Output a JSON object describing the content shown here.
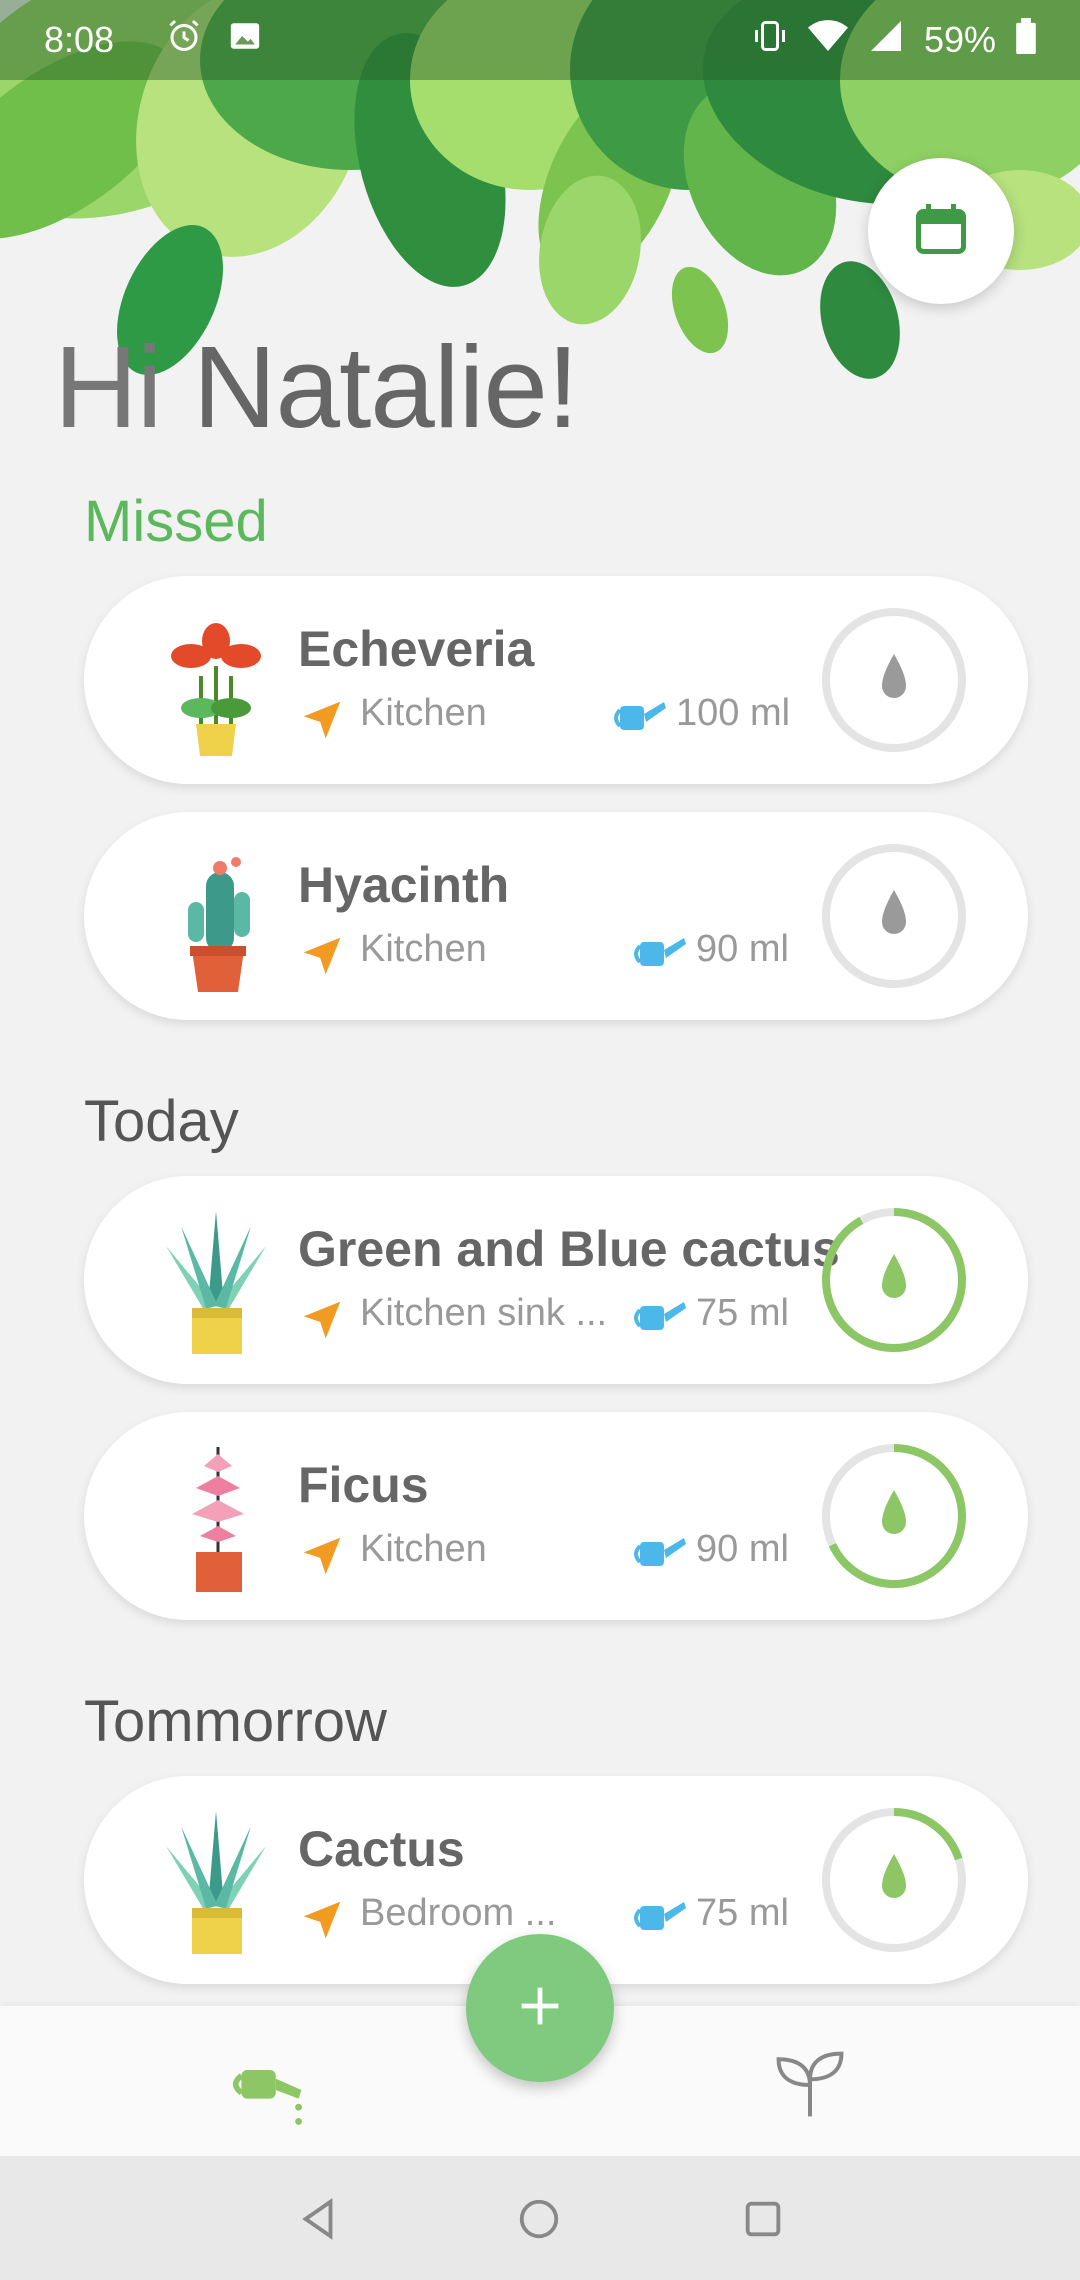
{
  "status_bar": {
    "time": "8:08",
    "battery": "59%",
    "icons": [
      "alarm-icon",
      "image-icon",
      "vibrate-icon",
      "wifi-icon",
      "signal-icon",
      "battery-icon"
    ]
  },
  "greeting": {
    "hi": "Hi",
    "name": "Natalie!"
  },
  "sections": {
    "missed": "Missed",
    "today": "Today",
    "tomorrow": "Tommorrow"
  },
  "plants": [
    {
      "name": "Echeveria",
      "location": "Kitchen",
      "amount": "100 ml",
      "progress": 0
    },
    {
      "name": "Hyacinth",
      "location": "Kitchen",
      "amount": "90 ml",
      "progress": 0
    },
    {
      "name": "Green and Blue cactus",
      "location": "Kitchen sink ...",
      "amount": "75 ml",
      "progress": 0.92
    },
    {
      "name": "Ficus",
      "location": "Kitchen",
      "amount": "90 ml",
      "progress": 0.68
    },
    {
      "name": "Cactus",
      "location": "Bedroom ...",
      "amount": "75 ml",
      "progress": 0.2
    }
  ],
  "colors": {
    "accent": "#8cc665",
    "missed": "#5cb85c",
    "location_icon": "#f29b22",
    "amount_icon": "#4cb8ea"
  },
  "bottom_nav": {
    "items": [
      "watering-can-icon",
      "plant-icon"
    ],
    "fab": "add-icon"
  },
  "system_nav": [
    "back-icon",
    "home-icon",
    "recents-icon"
  ]
}
